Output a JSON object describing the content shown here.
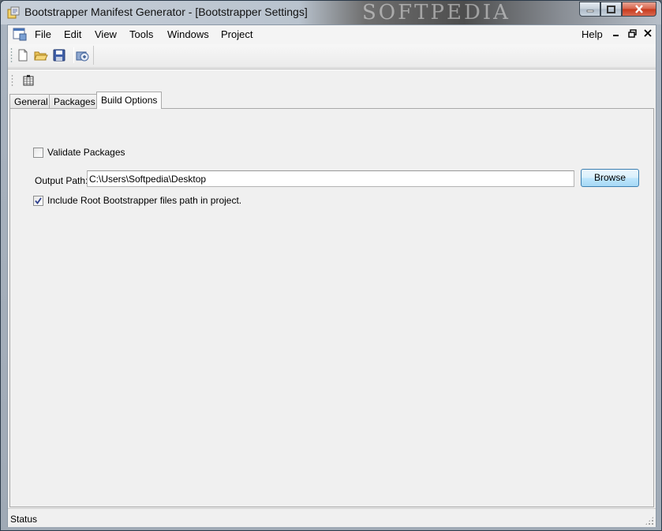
{
  "window": {
    "title": "Bootstrapper Manifest Generator - [Bootstrapper Settings]",
    "watermark": "SOFTPEDIA"
  },
  "menu": {
    "items": [
      "File",
      "Edit",
      "View",
      "Tools",
      "Windows",
      "Project"
    ],
    "help": "Help"
  },
  "toolbar": {
    "buttons": [
      "new-document-icon",
      "open-folder-icon",
      "save-icon",
      "build-icon"
    ]
  },
  "tabs": [
    {
      "label": "General",
      "active": false
    },
    {
      "label": "Packages",
      "active": false
    },
    {
      "label": "Build Options",
      "active": true
    }
  ],
  "build_options": {
    "validate_label": "Validate Packages",
    "validate_checked": false,
    "output_label": "Output Path:",
    "output_value": "C:\\Users\\Softpedia\\Desktop",
    "browse_label": "Browse",
    "include_label": "Include Root Bootstrapper files path in project.",
    "include_checked": true
  },
  "status": {
    "text": "Status"
  }
}
